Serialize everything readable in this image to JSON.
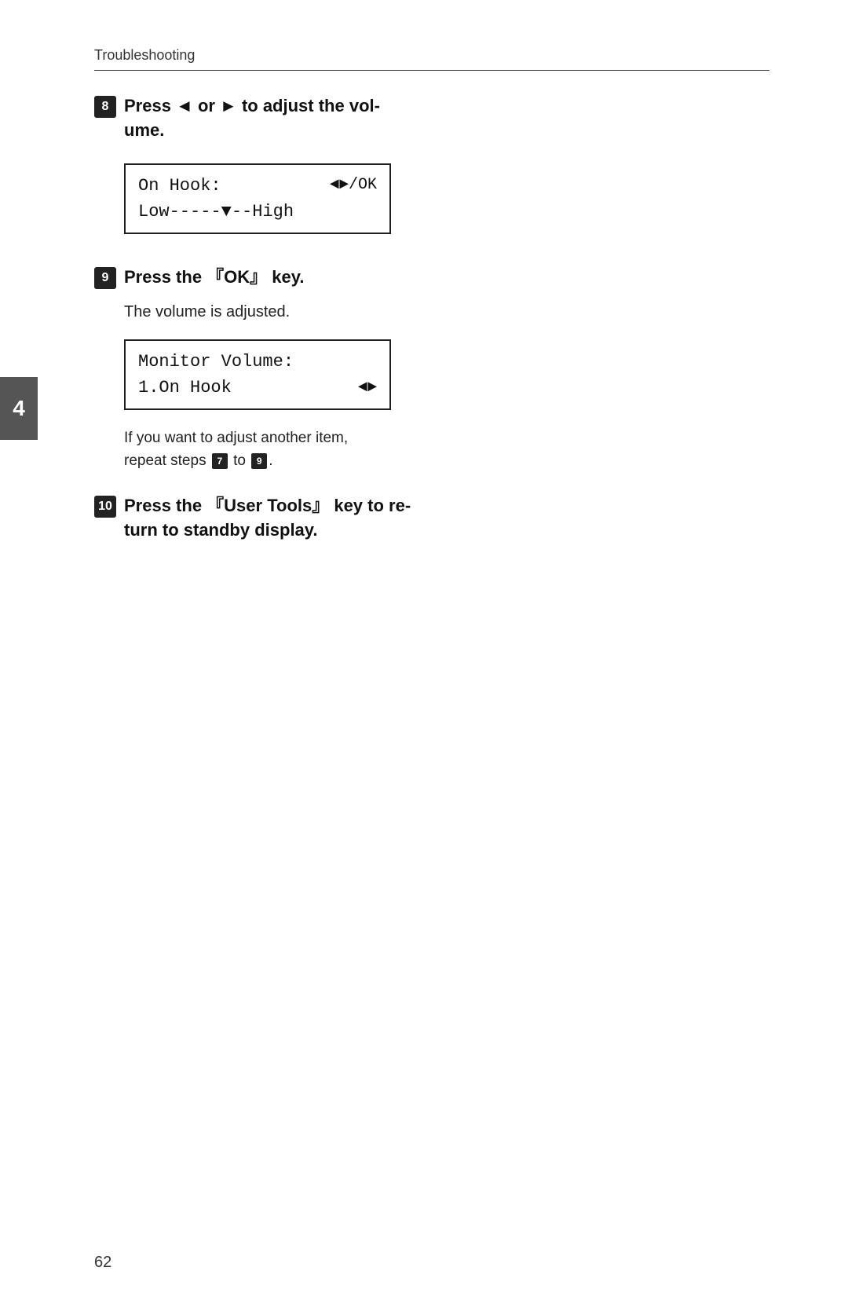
{
  "header": {
    "section_title": "Troubleshooting"
  },
  "chapter_tab": {
    "label": "4"
  },
  "steps": [
    {
      "id": "step8",
      "number": "8",
      "text": "Press ◄ or ▶ to adjust the vol-\nume.",
      "text_parts": [
        "Press ",
        " or ",
        " to adjust the vol-\nume."
      ],
      "lcd": {
        "lines": [
          {
            "left": "On Hook:",
            "right": "◄▶/OK"
          },
          {
            "left": "Low-----▼--High",
            "right": ""
          }
        ]
      }
    },
    {
      "id": "step9",
      "number": "9",
      "text": "Press the 『OK』 key.",
      "body": "The volume is adjusted.",
      "lcd": {
        "lines": [
          {
            "left": "Monitor Volume:",
            "right": ""
          },
          {
            "left": "1.On Hook",
            "right": "◄▶"
          }
        ]
      },
      "note": "If you want to adjust another item, repeat steps 7 to 9."
    },
    {
      "id": "step10",
      "number": "10",
      "text": "Press the 『User Tools』 key to re-\nturn to standby display."
    }
  ],
  "page_number": "62",
  "symbols": {
    "left_arrow": "◄",
    "right_arrow": "▶",
    "down_arrow": "▼",
    "lr_arrows": "◄▶"
  }
}
